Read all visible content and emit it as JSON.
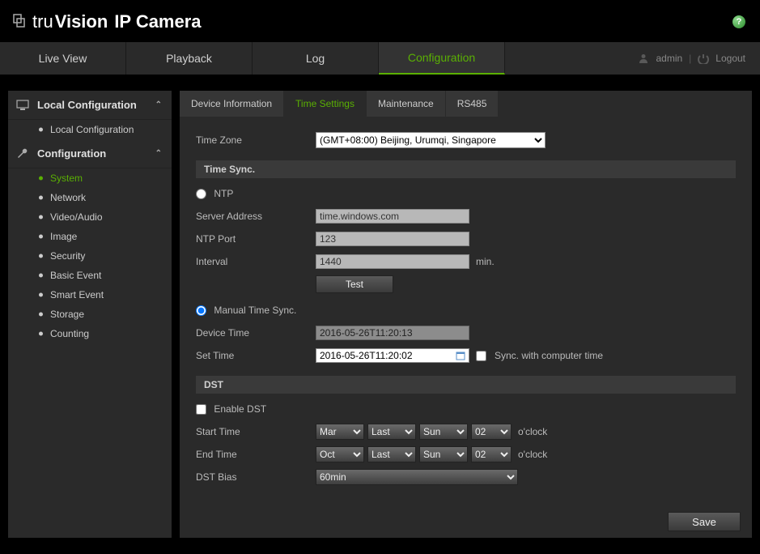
{
  "brand": {
    "part1": "tru",
    "part2": "Vision",
    "part3": "IP Camera"
  },
  "nav": {
    "tabs": [
      "Live View",
      "Playback",
      "Log",
      "Configuration"
    ],
    "active": 3,
    "username": "admin",
    "logout": "Logout"
  },
  "sidebar": {
    "sections": [
      {
        "title": "Local Configuration",
        "items": [
          "Local Configuration"
        ],
        "activeIndex": -1
      },
      {
        "title": "Configuration",
        "items": [
          "System",
          "Network",
          "Video/Audio",
          "Image",
          "Security",
          "Basic Event",
          "Smart Event",
          "Storage",
          "Counting"
        ],
        "activeIndex": 0
      }
    ]
  },
  "inner_tabs": {
    "items": [
      "Device Information",
      "Time Settings",
      "Maintenance",
      "RS485"
    ],
    "active": 1
  },
  "form": {
    "timezone_label": "Time Zone",
    "timezone_value": "(GMT+08:00) Beijing, Urumqi, Singapore",
    "timesync_header": "Time Sync.",
    "ntp_label": "NTP",
    "ntp_selected": false,
    "server_address_label": "Server Address",
    "server_address_value": "time.windows.com",
    "ntp_port_label": "NTP Port",
    "ntp_port_value": "123",
    "interval_label": "Interval",
    "interval_value": "1440",
    "interval_unit": "min.",
    "test_label": "Test",
    "manual_label": "Manual Time Sync.",
    "manual_selected": true,
    "device_time_label": "Device Time",
    "device_time_value": "2016-05-26T11:20:13",
    "set_time_label": "Set Time",
    "set_time_value": "2016-05-26T11:20:02",
    "sync_computer_label": "Sync. with computer time",
    "sync_computer_checked": false,
    "dst_header": "DST",
    "enable_dst_label": "Enable DST",
    "enable_dst_checked": false,
    "start_time_label": "Start Time",
    "start_month": "Mar",
    "start_week": "Last",
    "start_day": "Sun",
    "start_hour": "02",
    "end_time_label": "End Time",
    "end_month": "Oct",
    "end_week": "Last",
    "end_day": "Sun",
    "end_hour": "02",
    "oclock": "o'clock",
    "dst_bias_label": "DST Bias",
    "dst_bias_value": "60min",
    "save_label": "Save"
  }
}
